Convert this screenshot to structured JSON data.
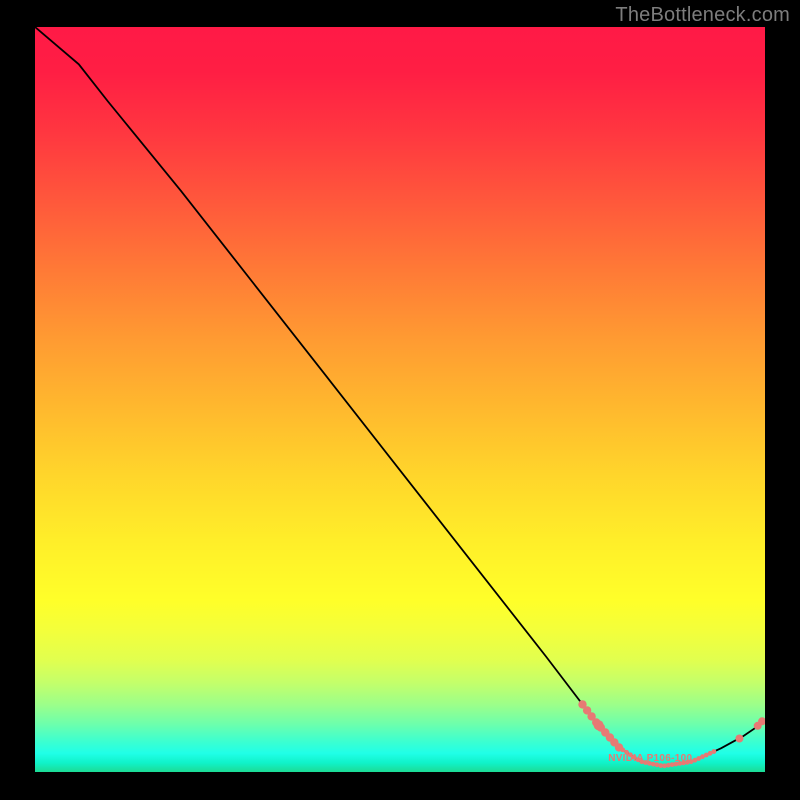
{
  "watermark": "TheBottleneck.com",
  "series_label": "NVIDIA P106-100",
  "accent_curve_color": "#000000",
  "dot_color": "#e77a74",
  "chart_data": {
    "type": "line",
    "title": "",
    "xlabel": "",
    "ylabel": "",
    "xlim": [
      0,
      100
    ],
    "ylim": [
      0,
      100
    ],
    "curve": [
      {
        "x": 0,
        "y": 100
      },
      {
        "x": 6,
        "y": 95
      },
      {
        "x": 10,
        "y": 90
      },
      {
        "x": 20,
        "y": 78
      },
      {
        "x": 30,
        "y": 65.5
      },
      {
        "x": 40,
        "y": 53
      },
      {
        "x": 50,
        "y": 40.5
      },
      {
        "x": 60,
        "y": 28
      },
      {
        "x": 70,
        "y": 15.5
      },
      {
        "x": 77,
        "y": 6.5
      },
      {
        "x": 80,
        "y": 3.3
      },
      {
        "x": 83,
        "y": 1.4
      },
      {
        "x": 86,
        "y": 0.8
      },
      {
        "x": 90,
        "y": 1.4
      },
      {
        "x": 94,
        "y": 3.2
      },
      {
        "x": 97,
        "y": 4.8
      },
      {
        "x": 100,
        "y": 6.8
      }
    ],
    "left_cluster_x_range": [
      75,
      80
    ],
    "bottom_scatter_x_range": [
      80,
      93
    ],
    "right_pairs": [
      {
        "x": 96.5,
        "y": 4.5
      },
      {
        "x": 99,
        "y": 6.2
      },
      {
        "x": 99.6,
        "y": 6.8
      }
    ],
    "gradient_stops": [
      {
        "pct": 0,
        "color": "#ff1a46"
      },
      {
        "pct": 24,
        "color": "#ff5a3b"
      },
      {
        "pct": 51,
        "color": "#ffb82e"
      },
      {
        "pct": 77,
        "color": "#ffff29"
      },
      {
        "pct": 93,
        "color": "#6effab"
      },
      {
        "pct": 100,
        "color": "#1cdc96"
      }
    ],
    "label_position": {
      "x": 84,
      "y": 1.8
    }
  }
}
